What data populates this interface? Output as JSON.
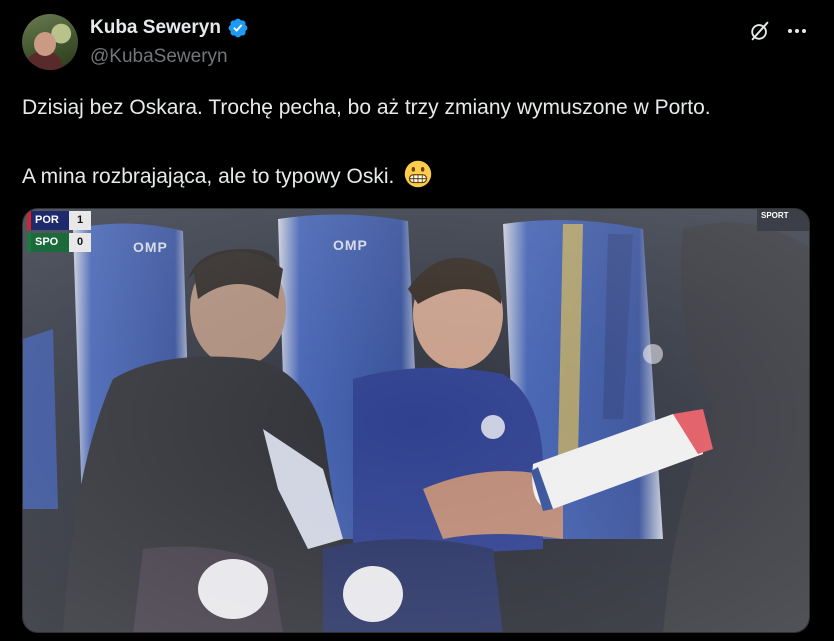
{
  "author": {
    "display_name": "Kuba Seweryn",
    "handle": "@KubaSeweryn",
    "verified": true,
    "avatar_icon": "profile-photo"
  },
  "header_icons": {
    "grok": "grok-icon",
    "more": "more-options-icon"
  },
  "tweet": {
    "line1": "Dzisiaj bez Oskara. Trochę pecha, bo aż trzy zmiany wymuszone w Porto.",
    "line2": "A mina rozbrajająca, ale to typowy Oski.",
    "emoji": "grimacing-face-icon"
  },
  "media": {
    "scoreboard": {
      "home_team": "POR",
      "home_score": "1",
      "away_team": "SPO",
      "away_score": "0"
    },
    "broadcaster": "SPORT",
    "seat_brand": "OMP"
  },
  "colors": {
    "background": "#000000",
    "text": "#e7e9ea",
    "secondary_text": "#71767b",
    "verified": "#1d9bf0",
    "border": "#2f3336"
  }
}
